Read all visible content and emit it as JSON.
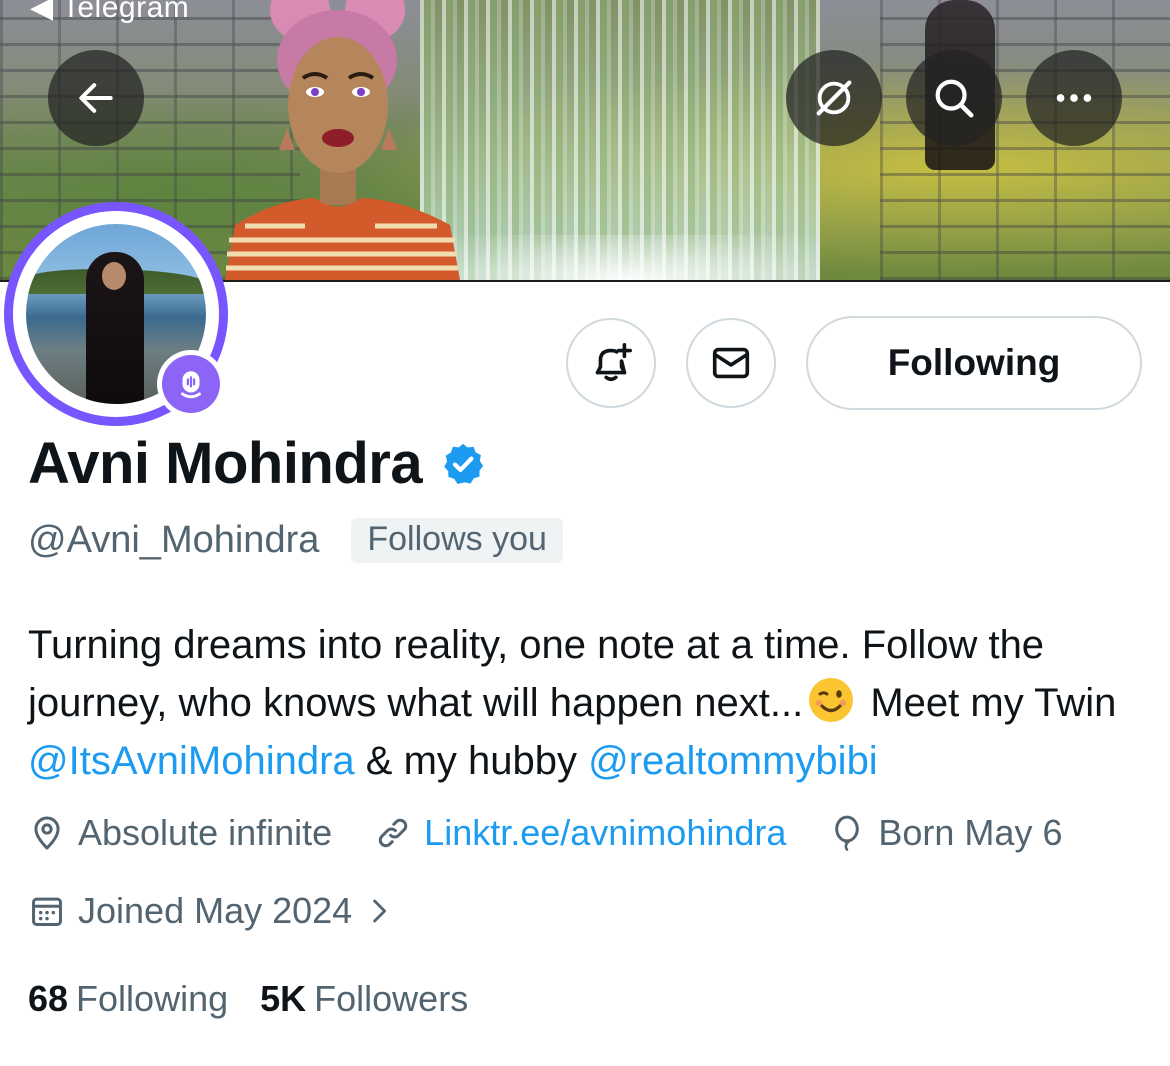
{
  "status_bar": {
    "back_app_label": "◀ Telegram"
  },
  "banner": {
    "icons": {
      "back": "arrow-left-icon",
      "grok": "grok-slash-icon",
      "search": "search-icon",
      "more": "more-dots-icon"
    }
  },
  "profile": {
    "display_name": "Avni Mohindra",
    "verified": true,
    "handle": "@Avni_Mohindra",
    "follows_you_label": "Follows you",
    "bio": {
      "text1": "Turning dreams into reality, one note at a time. Follow the journey, who knows what will happen next...",
      "emoji": "😉",
      "text2": " Meet my Twin ",
      "mention1": "@ItsAvniMohindra",
      "text3": " & my hubby ",
      "mention2": "@realtommybibi"
    },
    "location": "Absolute infinite",
    "link": "Linktr.ee/avnimohindra",
    "birthday": "Born May 6",
    "joined": "Joined May 2024",
    "following_count": "68",
    "following_label": "Following",
    "followers_count": "5K",
    "followers_label": "Followers"
  },
  "actions": {
    "notify_icon": "bell-plus-icon",
    "message_icon": "mail-icon",
    "following_button": "Following"
  },
  "colors": {
    "accent": "#1d9bf0",
    "spaces_ring": "#7856ff",
    "secondary_text": "#536471",
    "primary_text": "#0f1419"
  }
}
